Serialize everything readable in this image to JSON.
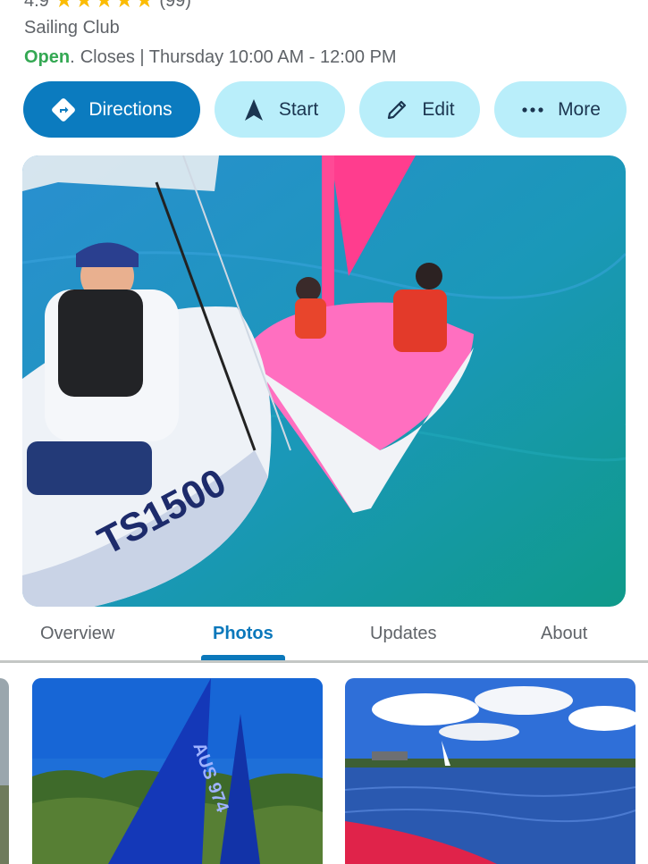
{
  "place": {
    "rating": "4.9",
    "review_count": "(99)",
    "stars": 5,
    "category": "Sailing Club",
    "status": "Open",
    "status_separator": ".",
    "hours_text": "Closes | Thursday  10:00 AM - 12:00 PM"
  },
  "actions": {
    "directions": "Directions",
    "start": "Start",
    "edit": "Edit",
    "more": "More"
  },
  "tabs": [
    {
      "label": "Overview"
    },
    {
      "label": "Photos"
    },
    {
      "label": "Updates"
    },
    {
      "label": "About"
    }
  ],
  "active_tab": "Photos",
  "colors": {
    "primary": "#0b7bbf",
    "light_button": "#b9eefa",
    "open_green": "#34a853",
    "star": "#fbbc04"
  }
}
